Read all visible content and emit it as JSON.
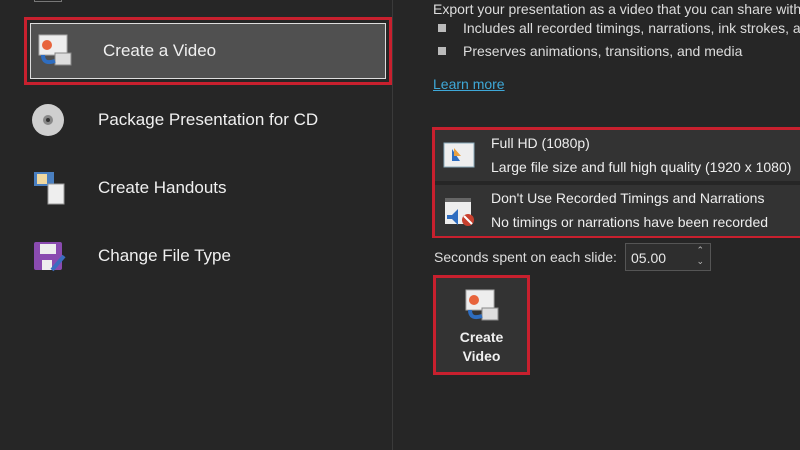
{
  "sidebar": {
    "items": [
      {
        "label": "Create a Video",
        "icon": "create-video-icon",
        "selected": true
      },
      {
        "label": "Package Presentation for CD",
        "icon": "cd-icon"
      },
      {
        "label": "Create Handouts",
        "icon": "handouts-icon"
      },
      {
        "label": "Change File Type",
        "icon": "save-as-icon"
      }
    ]
  },
  "main": {
    "description": "Export your presentation as a video that you can share with",
    "bullets": [
      "Includes all recorded timings, narrations, ink strokes, a",
      "Preserves animations, transitions, and media"
    ],
    "learn_more": "Learn more",
    "quality": {
      "title": "Full HD (1080p)",
      "subtitle": "Large file size and full high quality (1920 x 1080)"
    },
    "timings": {
      "title": "Don't Use Recorded Timings and Narrations",
      "subtitle": "No timings or narrations have been recorded"
    },
    "seconds_label": "Seconds spent on each slide:",
    "seconds_value": "05.00",
    "create_button": [
      "Create",
      "Video"
    ]
  },
  "colors": {
    "highlight": "#c8202e",
    "link": "#3ea8d8"
  }
}
